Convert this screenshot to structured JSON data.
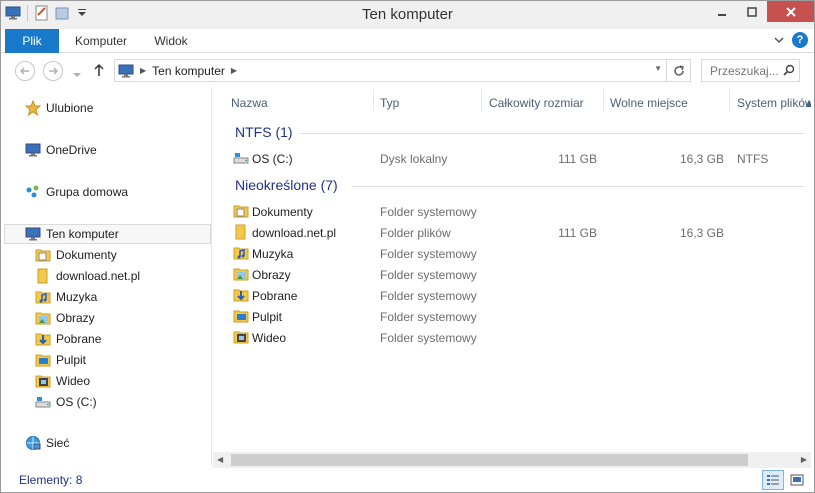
{
  "window": {
    "title": "Ten komputer"
  },
  "ribbon": {
    "tabs": [
      {
        "label": "Plik"
      },
      {
        "label": "Komputer"
      },
      {
        "label": "Widok"
      }
    ]
  },
  "address": {
    "crumbs": [
      "Ten komputer"
    ],
    "search_placeholder": "Przeszukaj..."
  },
  "nav": {
    "items": [
      {
        "label": "Ulubione",
        "icon": "star-icon"
      },
      {
        "label": "OneDrive",
        "icon": "computer-icon"
      },
      {
        "label": "Grupa domowa",
        "icon": "homegroup-icon"
      },
      {
        "label": "Ten komputer",
        "icon": "computer-icon"
      },
      {
        "label": "Dokumenty",
        "icon": "documents-folder-icon"
      },
      {
        "label": "download.net.pl",
        "icon": "folder-icon"
      },
      {
        "label": "Muzyka",
        "icon": "music-folder-icon"
      },
      {
        "label": "Obrazy",
        "icon": "pictures-folder-icon"
      },
      {
        "label": "Pobrane",
        "icon": "downloads-folder-icon"
      },
      {
        "label": "Pulpit",
        "icon": "desktop-folder-icon"
      },
      {
        "label": "Wideo",
        "icon": "video-folder-icon"
      },
      {
        "label": "OS (C:)",
        "icon": "drive-icon"
      },
      {
        "label": "Sieć",
        "icon": "network-icon"
      }
    ]
  },
  "columns": [
    "Nazwa",
    "Typ",
    "Całkowity rozmiar",
    "Wolne miejsce",
    "System plików"
  ],
  "groups": [
    {
      "title": "NTFS (1)",
      "rows": [
        {
          "name": "OS (C:)",
          "type": "Dysk lokalny",
          "size": "111 GB",
          "free": "16,3 GB",
          "fs": "NTFS",
          "icon": "drive-icon"
        }
      ]
    },
    {
      "title": "Nieokreślone (7)",
      "rows": [
        {
          "name": "Dokumenty",
          "type": "Folder systemowy",
          "size": "",
          "free": "",
          "fs": "",
          "icon": "documents-folder-icon"
        },
        {
          "name": "download.net.pl",
          "type": "Folder plików",
          "size": "111 GB",
          "free": "16,3 GB",
          "fs": "",
          "icon": "folder-icon"
        },
        {
          "name": "Muzyka",
          "type": "Folder systemowy",
          "size": "",
          "free": "",
          "fs": "",
          "icon": "music-folder-icon"
        },
        {
          "name": "Obrazy",
          "type": "Folder systemowy",
          "size": "",
          "free": "",
          "fs": "",
          "icon": "pictures-folder-icon"
        },
        {
          "name": "Pobrane",
          "type": "Folder systemowy",
          "size": "",
          "free": "",
          "fs": "",
          "icon": "downloads-folder-icon"
        },
        {
          "name": "Pulpit",
          "type": "Folder systemowy",
          "size": "",
          "free": "",
          "fs": "",
          "icon": "desktop-folder-icon"
        },
        {
          "name": "Wideo",
          "type": "Folder systemowy",
          "size": "",
          "free": "",
          "fs": "",
          "icon": "video-folder-icon"
        }
      ]
    }
  ],
  "status": {
    "count": "Elementy: 8"
  },
  "colors": {
    "accent": "#1979ca",
    "group_title": "#1e3287",
    "header_text": "#4c607a"
  }
}
